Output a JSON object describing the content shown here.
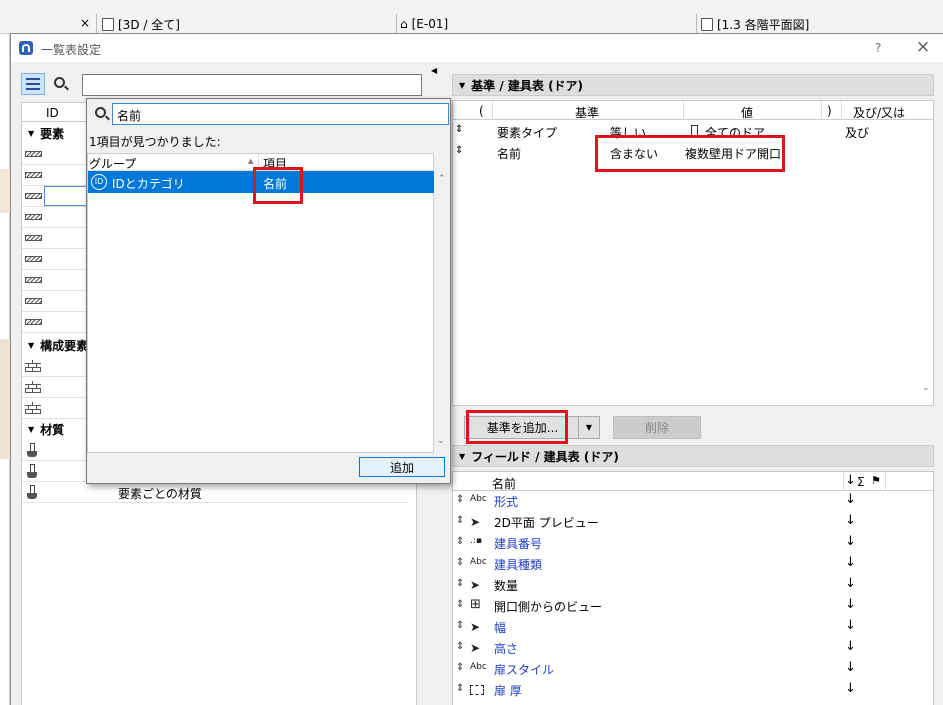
{
  "bg_tabs": {
    "t1": "[3D / 全て]",
    "t1_close": "×",
    "t2": "[E-01]",
    "t3": "[1.3 各階平面図]"
  },
  "dialog": {
    "title": "一覧表設定",
    "help": "?",
    "close": "×"
  },
  "left": {
    "col_id": "ID",
    "sections": {
      "elements": "要素",
      "components": "構成要素",
      "materials": "材質"
    },
    "material_row_text": "要素ごとの材質"
  },
  "popup": {
    "search_value": "名前",
    "found_text": "1項目が見つかりました:",
    "col_group": "グループ",
    "col_item": "項目",
    "result": {
      "group": "IDとカテゴリ",
      "item": "名前",
      "badge": "ID"
    },
    "add_button": "追加"
  },
  "criteria": {
    "header": "基準 /  建具表 (ドア)",
    "cols": {
      "open": "(",
      "criteria": "基準",
      "value": "値",
      "close": ")",
      "andor": "及び/又は"
    },
    "rows": [
      {
        "field": "要素タイプ",
        "op": "等しい",
        "value": "全てのドア",
        "andor": "及び"
      },
      {
        "field": "名前",
        "op": "含まない",
        "value": "複数壁用ドア開口",
        "andor": ""
      }
    ],
    "add_button": "基準を追加...",
    "delete_button": "削除"
  },
  "fields": {
    "header": "フィールド /  建具表 (ドア)",
    "col_name": "名前",
    "col_sigma": "Σ",
    "rows": [
      {
        "icon": "Abc",
        "name": "形式",
        "blue": true
      },
      {
        "icon": "cursor",
        "name": "2D平面 プレビュー",
        "blue": false
      },
      {
        "icon": "dots",
        "name": "建具番号",
        "blue": true
      },
      {
        "icon": "Abc",
        "name": "建具種類",
        "blue": true
      },
      {
        "icon": "cursor",
        "name": "数量",
        "blue": false
      },
      {
        "icon": "window",
        "name": "開口側からのビュー",
        "blue": false
      },
      {
        "icon": "cursor",
        "name": "幅",
        "blue": true
      },
      {
        "icon": "cursor",
        "name": "高さ",
        "blue": true
      },
      {
        "icon": "Abc",
        "name": "扉スタイル",
        "blue": true
      },
      {
        "icon": "dashbox",
        "name": "扉 厚",
        "blue": true
      }
    ]
  }
}
